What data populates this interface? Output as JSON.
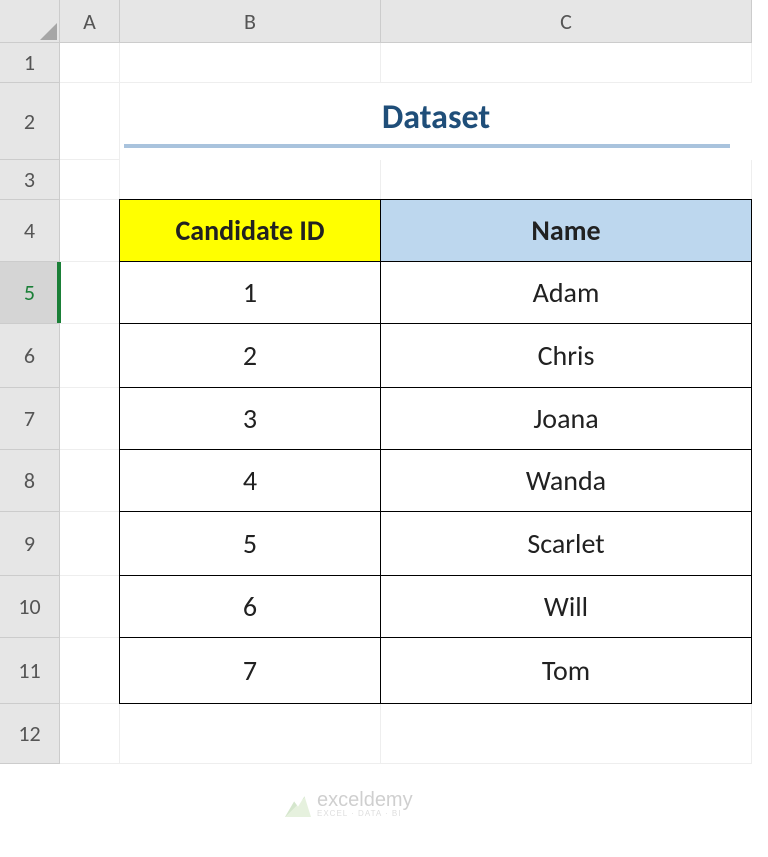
{
  "columns": [
    "A",
    "B",
    "C"
  ],
  "rows": [
    "1",
    "2",
    "3",
    "4",
    "5",
    "6",
    "7",
    "8",
    "9",
    "10",
    "11",
    "12"
  ],
  "selected_row": 5,
  "title": "Dataset",
  "table": {
    "headers": {
      "b": "Candidate ID",
      "c": "Name"
    },
    "data": [
      {
        "id": "1",
        "name": "Adam"
      },
      {
        "id": "2",
        "name": "Chris"
      },
      {
        "id": "3",
        "name": "Joana"
      },
      {
        "id": "4",
        "name": "Wanda"
      },
      {
        "id": "5",
        "name": "Scarlet"
      },
      {
        "id": "6",
        "name": "Will"
      },
      {
        "id": "7",
        "name": "Tom"
      }
    ]
  },
  "watermark": {
    "brand": "exceldemy",
    "tagline": "EXCEL · DATA · BI"
  }
}
